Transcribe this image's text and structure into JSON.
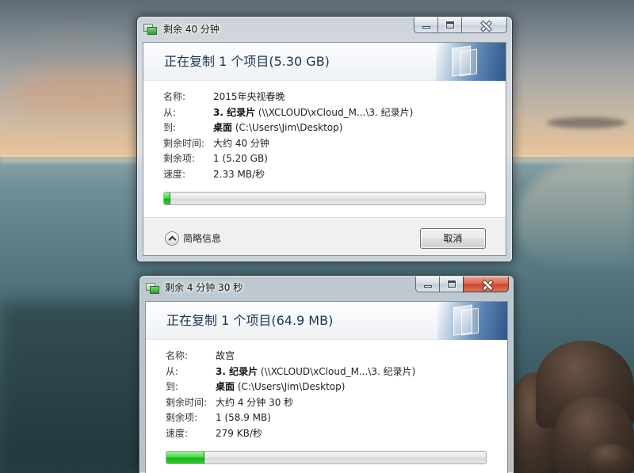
{
  "dialogs": [
    {
      "title": "剩余 40 分钟",
      "heading": "正在复制 1 个项目(5.30 GB)",
      "details": {
        "name": "2015年央视春晚",
        "from_bold": "3. 纪录片",
        "from_path": "(\\\\XCLOUD\\xCloud_M...\\3. 纪录片)",
        "to_bold": "桌面",
        "to_path": "(C:\\Users\\Jim\\Desktop)",
        "time_remaining": "大约 40 分钟",
        "items_remaining": "1 (5.20 GB)",
        "speed": "2.33 MB/秒"
      },
      "progress": 0.02,
      "footer": {
        "details_toggle": "简略信息",
        "cancel": "取消"
      }
    },
    {
      "title": "剩余 4 分钟 30 秒",
      "heading": "正在复制 1 个项目(64.9 MB)",
      "details": {
        "name": "故宫",
        "from_bold": "3. 纪录片",
        "from_path": "(\\\\XCLOUD\\xCloud_M...\\3. 纪录片)",
        "to_bold": "桌面",
        "to_path": "(C:\\Users\\Jim\\Desktop)",
        "time_remaining": "大约 4 分钟 30 秒",
        "items_remaining": "1 (58.9 MB)",
        "speed": "279 KB/秒"
      },
      "progress": 0.12
    }
  ],
  "labels": {
    "name": "名称:",
    "from": "从:",
    "to": "到:",
    "time_remaining": "剩余时间:",
    "items_remaining": "剩余项:",
    "speed": "速度:"
  },
  "icons": {
    "title_icon": "copy-icon",
    "minimize": "minimize-icon",
    "maximize": "maximize-icon",
    "close": "close-icon",
    "details_toggle": "chevron-up-circle-icon"
  },
  "colors": {
    "progress_fill": "#1db41f",
    "heading_text": "#1c3553",
    "close_button_active": "#c9462c"
  }
}
